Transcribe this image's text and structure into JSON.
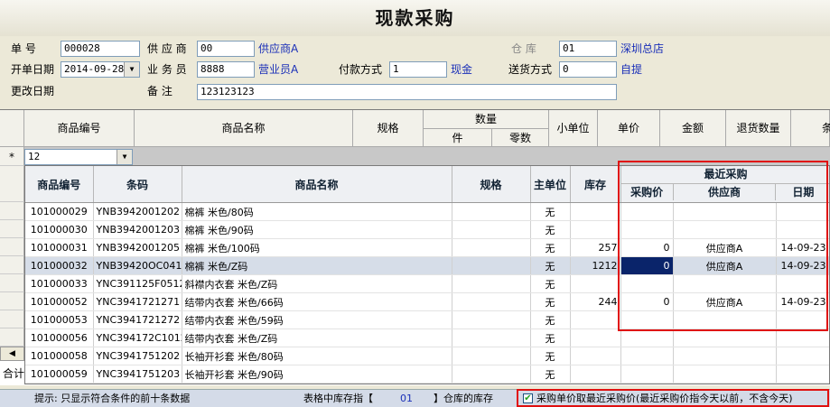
{
  "title": "现款采购",
  "form": {
    "doc_no_label": "单    号",
    "doc_no_value": "000028",
    "supplier_label": "供 应 商",
    "supplier_code": "00",
    "supplier_name": "供应商A",
    "warehouse_label": "仓    库",
    "warehouse_code": "01",
    "warehouse_name": "深圳总店",
    "open_date_label": "开单日期",
    "open_date_value": "2014-09-28",
    "salesman_label": "业 务 员",
    "salesman_code": "8888",
    "salesman_name": "营业员A",
    "payment_label": "付款方式",
    "payment_code": "1",
    "payment_name": "现金",
    "delivery_label": "送货方式",
    "delivery_code": "0",
    "delivery_name": "自提",
    "change_date_label": "更改日期",
    "remark_label": "备    注",
    "remark_value": "123123123"
  },
  "main_grid": {
    "headers": {
      "code": "商品编号",
      "name": "商品名称",
      "spec": "规格",
      "qty": "数量",
      "qty_piece": "件",
      "qty_loose": "零数",
      "small_unit": "小单位",
      "price": "单价",
      "amount": "金额",
      "return_qty": "退货数量",
      "cut": "条"
    },
    "row_marker": "*",
    "input_value": "12",
    "total_label": "合计"
  },
  "lookup": {
    "headers": {
      "code": "商品编号",
      "barcode": "条码",
      "name": "商品名称",
      "spec": "规格",
      "unit": "主单位",
      "stock": "库存",
      "recent_group": "最近采购",
      "recent_price": "采购价",
      "recent_supplier": "供应商",
      "recent_date": "日期"
    },
    "rows": [
      {
        "code": "101000029",
        "barcode": "YNB3942001202",
        "name": "棉裤  米色/80码",
        "spec": "",
        "unit": "无",
        "stock": "",
        "price": "",
        "supplier": "",
        "date": ""
      },
      {
        "code": "101000030",
        "barcode": "YNB3942001203",
        "name": "棉裤  米色/90码",
        "spec": "",
        "unit": "无",
        "stock": "",
        "price": "",
        "supplier": "",
        "date": ""
      },
      {
        "code": "101000031",
        "barcode": "YNB3942001205",
        "name": "棉裤  米色/100码",
        "spec": "",
        "unit": "无",
        "stock": "257",
        "price": "0",
        "supplier": "供应商A",
        "date": "14-09-23"
      },
      {
        "code": "101000032",
        "barcode": "YNB39420OC0412Z",
        "name": "棉裤  米色/Z码",
        "spec": "",
        "unit": "无",
        "stock": "1212",
        "price": "0",
        "supplier": "供应商A",
        "date": "14-09-23"
      },
      {
        "code": "101000033",
        "barcode": "YNC391125F0512Z",
        "name": "斜襟内衣套  米色/Z码",
        "spec": "",
        "unit": "无",
        "stock": "",
        "price": "",
        "supplier": "",
        "date": ""
      },
      {
        "code": "101000052",
        "barcode": "YNC3941721271",
        "name": "结带内衣套  米色/66码",
        "spec": "",
        "unit": "无",
        "stock": "244",
        "price": "0",
        "supplier": "供应商A",
        "date": "14-09-23"
      },
      {
        "code": "101000053",
        "barcode": "YNC3941721272",
        "name": "结带内衣套  米色/59码",
        "spec": "",
        "unit": "无",
        "stock": "",
        "price": "",
        "supplier": "",
        "date": ""
      },
      {
        "code": "101000056",
        "barcode": "YNC394172C1012Z",
        "name": "结带内衣套  米色/Z码",
        "spec": "",
        "unit": "无",
        "stock": "",
        "price": "",
        "supplier": "",
        "date": ""
      },
      {
        "code": "101000058",
        "barcode": "YNC3941751202",
        "name": "长袖开衫套  米色/80码",
        "spec": "",
        "unit": "无",
        "stock": "",
        "price": "",
        "supplier": "",
        "date": ""
      },
      {
        "code": "101000059",
        "barcode": "YNC3941751203",
        "name": "长袖开衫套  米色/90码",
        "spec": "",
        "unit": "无",
        "stock": "",
        "price": "",
        "supplier": "",
        "date": ""
      }
    ]
  },
  "status": {
    "hint": "提示:  只显示符合条件的前十条数据",
    "stock_prefix": "表格中库存指【",
    "stock_wh": "01",
    "stock_suffix": "】仓库的库存",
    "checkbox_label": "采购单价取最近采购价(最近采购价指今天以前，不含今天)",
    "checkbox_checked": true
  }
}
